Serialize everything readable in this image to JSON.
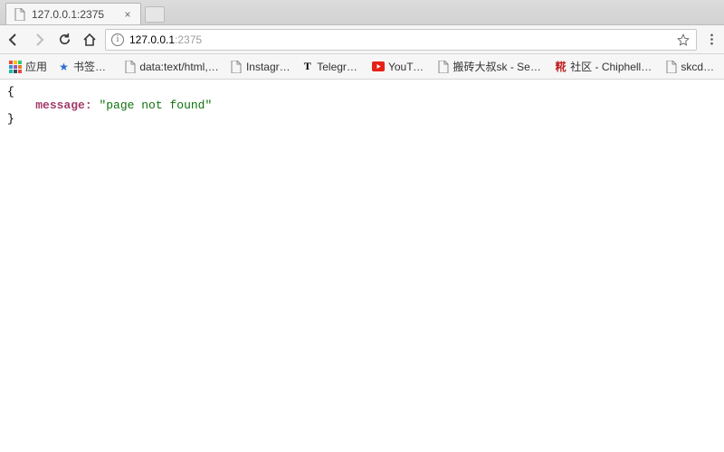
{
  "tab": {
    "title": "127.0.0.1:2375"
  },
  "omnibox": {
    "host": "127.0.0.1",
    "port": ":2375"
  },
  "bookmarks": {
    "apps_label": "应用",
    "items": [
      {
        "label": "书签导航",
        "icon": "star"
      },
      {
        "label": "data:text/html, <ht",
        "icon": "page"
      },
      {
        "label": "Instagram",
        "icon": "page"
      },
      {
        "label": "Telegraph",
        "icon": "telegraph"
      },
      {
        "label": "YouTube",
        "icon": "youtube"
      },
      {
        "label": "搬砖大叔sk - Segme",
        "icon": "page"
      },
      {
        "label": "社区 - Chiphell - 分",
        "icon": "chiphell"
      },
      {
        "label": "skcdian",
        "icon": "page"
      }
    ]
  },
  "body": {
    "open": "{",
    "key": "message:",
    "value": "\"page not found\"",
    "close": "}"
  }
}
